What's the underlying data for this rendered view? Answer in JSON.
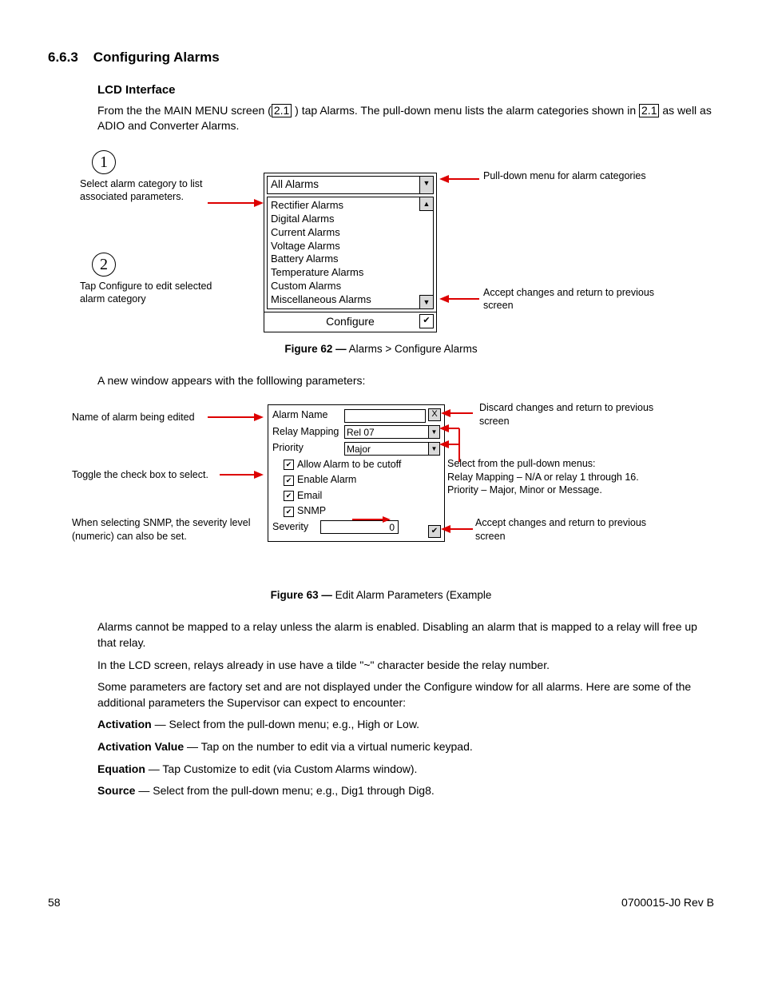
{
  "section": {
    "number": "6.6.3",
    "title": "Configuring Alarms",
    "sub_title": "LCD Interface",
    "intro_a": "From the the MAIN MENU screen (",
    "ref1": "2.1",
    "intro_b": " ) tap Alarms. The pull-down menu lists the alarm categories shown in ",
    "ref2": "2.1",
    "intro_c": " as well as ADIO and Converter Alarms."
  },
  "fig62": {
    "step1_num": "1",
    "step1_text": "Select alarm category to list associated parameters.",
    "step2_num": "2",
    "step2_text": "Tap Configure to edit selected alarm category",
    "pulldown_label": "Pull-down menu for alarm categories",
    "accept_label": "Accept changes and return to previous screen",
    "dropdown_selected": "All Alarms",
    "list_items": [
      "Rectifier Alarms",
      "Digital Alarms",
      "Current Alarms",
      "Voltage Alarms",
      "Battery Alarms",
      "Temperature Alarms",
      "Custom Alarms",
      "Miscellaneous Alarms"
    ],
    "configure_btn": "Configure",
    "caption_label": "Figure 62  —",
    "caption_text": "  Alarms > Configure Alarms"
  },
  "mid_text": "A new window appears with the folllowing parameters:",
  "fig63": {
    "left_name": "Name of alarm being edited",
    "left_toggle": "Toggle the check box to select.",
    "left_snmp": "When selecting SNMP, the severity level (numeric) can also be set.",
    "right_discard": "Discard changes and return to previous screen",
    "right_select_a": "Select from the pull-down menus:",
    "right_select_b": "Relay Mapping – N/A or relay 1 through 16.",
    "right_select_c": "Priority – Major, Minor or Message.",
    "right_accept": "Accept changes and return to previous screen",
    "alarm_name_label": "Alarm Name",
    "relay_label": "Relay Mapping",
    "relay_value": "Rel 07",
    "priority_label": "Priority",
    "priority_value": "Major",
    "chk1": "Allow Alarm to be cutoff",
    "chk2": "Enable Alarm",
    "chk3": "Email",
    "chk4": "SNMP",
    "severity_label": "Severity",
    "severity_value": "0",
    "caption_label": "Figure 63  —",
    "caption_text": "  Edit Alarm Parameters (Example"
  },
  "para1": "Alarms cannot be mapped to a relay unless the alarm is enabled. Disabling an alarm that is mapped to a relay will free up that relay.",
  "para2": "In the LCD screen, relays already in use have a tilde \"~\" character beside the relay number.",
  "para3": "Some parameters are factory set and are not displayed under the Configure window for all alarms. Here are some of the additional parameters the Supervisor can expect to encounter:",
  "params": {
    "activation_b": "Activation",
    "activation_t": " — Select from the pull-down menu; e.g., High or Low.",
    "actval_b": "Activation Value",
    "actval_t": " — Tap on the number to edit via a virtual numeric keypad.",
    "eq_b": "Equation",
    "eq_t": " — Tap Customize to edit (via Custom Alarms window).",
    "src_b": "Source",
    "src_t": " — Select from the pull-down menu; e.g., Dig1 through Dig8."
  },
  "footer": {
    "page": "58",
    "docid": "0700015-J0    Rev B"
  }
}
